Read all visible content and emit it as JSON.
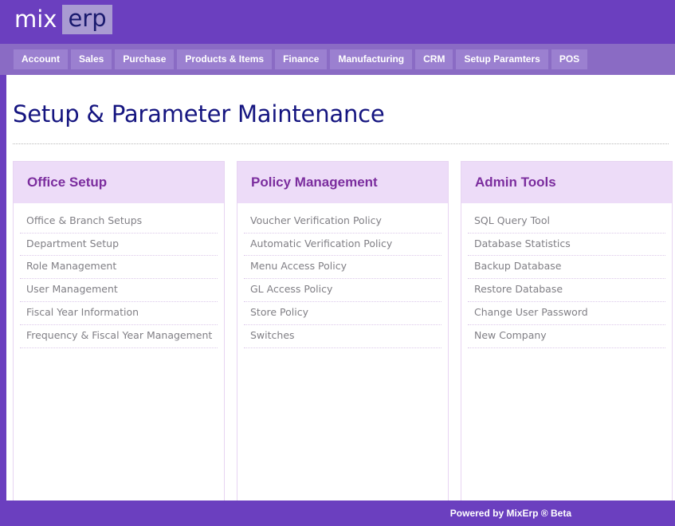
{
  "brand": {
    "logo_primary": "mix",
    "logo_secondary": "erp",
    "header_color": "#6B3FBF",
    "nav_color": "#8A6BC4",
    "tab_color": "#9B80D0",
    "panel_header_color": "#EDDCF8",
    "panel_title_color": "#7B2D9E",
    "title_color": "#151580"
  },
  "nav": {
    "tabs": [
      {
        "label": "Account"
      },
      {
        "label": "Sales"
      },
      {
        "label": "Purchase"
      },
      {
        "label": "Products & Items"
      },
      {
        "label": "Finance"
      },
      {
        "label": "Manufacturing"
      },
      {
        "label": "CRM"
      },
      {
        "label": "Setup Paramters"
      },
      {
        "label": "POS"
      }
    ]
  },
  "page": {
    "title": "Setup & Parameter Maintenance"
  },
  "panels": [
    {
      "title": "Office Setup",
      "items": [
        {
          "label": "Office & Branch Setups"
        },
        {
          "label": "Department Setup"
        },
        {
          "label": "Role Management"
        },
        {
          "label": "User Management"
        },
        {
          "label": "Fiscal Year Information"
        },
        {
          "label": "Frequency & Fiscal Year Management"
        }
      ]
    },
    {
      "title": "Policy Management",
      "items": [
        {
          "label": "Voucher Verification Policy"
        },
        {
          "label": "Automatic Verification Policy"
        },
        {
          "label": "Menu Access Policy"
        },
        {
          "label": "GL Access Policy"
        },
        {
          "label": "Store Policy"
        },
        {
          "label": "Switches"
        }
      ]
    },
    {
      "title": "Admin Tools",
      "items": [
        {
          "label": "SQL Query Tool"
        },
        {
          "label": "Database Statistics"
        },
        {
          "label": "Backup Database"
        },
        {
          "label": "Restore Database"
        },
        {
          "label": "Change User Password"
        },
        {
          "label": "New Company"
        }
      ]
    }
  ],
  "footer": {
    "text": "Powered by MixErp ® Beta"
  }
}
